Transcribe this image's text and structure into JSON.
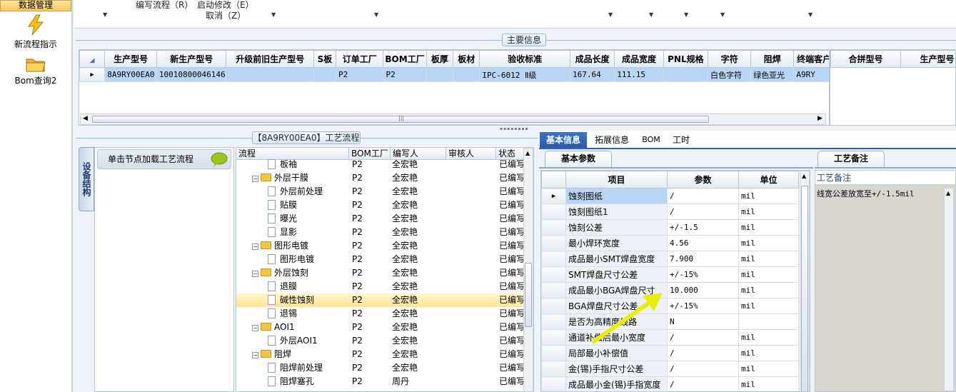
{
  "nav": {
    "header": "数据管理",
    "items": [
      {
        "label": "新流程指示",
        "icon": "lightning-icon"
      },
      {
        "label": "Bom查询2",
        "icon": "folder-icon"
      }
    ]
  },
  "toolbar": {
    "edit_flow": "编写流程（R）",
    "start_modify": "启动修改（E）",
    "cancel": "取消（Z）"
  },
  "main_info": {
    "title": "主要信息",
    "columns": [
      "生产型号",
      "新生产型号",
      "升级前旧生产型号",
      "S板",
      "订单工厂",
      "BOM工厂",
      "板厚",
      "板材",
      "验收标准",
      "成品长度",
      "成品宽度",
      "PNL规格",
      "字符",
      "阻焊",
      "终端客户代"
    ],
    "rows": [
      [
        "8A9RY00EA0",
        "10010800046146",
        "",
        "",
        "P2",
        "P2",
        "",
        "",
        "IPC-6012 Ⅱ级",
        "167.64",
        "111.15",
        "",
        "白色字符",
        "绿色亚光",
        "A9RY"
      ]
    ],
    "side_columns": [
      "合拼型号",
      "生产型号"
    ]
  },
  "flow": {
    "title": "【8A9RY00EA0】工艺流程",
    "device_tab": "设备结构",
    "load_hint": "单击节点加载工艺流程",
    "columns": [
      "流程",
      "BOM工厂",
      "编写人",
      "审核人",
      "状态"
    ],
    "rows": [
      {
        "name": "板袖",
        "kind": "doc",
        "level": 2,
        "bom": "P2",
        "author": "全宏艳",
        "reviewer": "",
        "status": "已编写"
      },
      {
        "name": "外层干膜",
        "kind": "folder",
        "level": 1,
        "bom": "P2",
        "author": "全宏艳",
        "reviewer": "",
        "status": "已编写"
      },
      {
        "name": "外层前处理",
        "kind": "doc",
        "level": 2,
        "bom": "P2",
        "author": "全宏艳",
        "reviewer": "",
        "status": "已编写"
      },
      {
        "name": "贴膜",
        "kind": "doc",
        "level": 2,
        "bom": "P2",
        "author": "全宏艳",
        "reviewer": "",
        "status": "已编写"
      },
      {
        "name": "曝光",
        "kind": "doc",
        "level": 2,
        "bom": "P2",
        "author": "全宏艳",
        "reviewer": "",
        "status": "已编写"
      },
      {
        "name": "显影",
        "kind": "doc",
        "level": 2,
        "bom": "P2",
        "author": "全宏艳",
        "reviewer": "",
        "status": "已编写"
      },
      {
        "name": "图形电镀",
        "kind": "folder",
        "level": 1,
        "bom": "P2",
        "author": "全宏艳",
        "reviewer": "",
        "status": "已编写"
      },
      {
        "name": "图形电镀",
        "kind": "doc",
        "level": 2,
        "bom": "P2",
        "author": "全宏艳",
        "reviewer": "",
        "status": "已编写"
      },
      {
        "name": "外层蚀刻",
        "kind": "folder",
        "level": 1,
        "bom": "P2",
        "author": "全宏艳",
        "reviewer": "",
        "status": "已编写"
      },
      {
        "name": "退膜",
        "kind": "doc",
        "level": 2,
        "bom": "P2",
        "author": "全宏艳",
        "reviewer": "",
        "status": "已编写"
      },
      {
        "name": "碱性蚀刻",
        "kind": "doc",
        "level": 2,
        "bom": "P2",
        "author": "全宏艳",
        "reviewer": "",
        "status": "已编写",
        "selected": true
      },
      {
        "name": "退锡",
        "kind": "doc",
        "level": 2,
        "bom": "P2",
        "author": "全宏艳",
        "reviewer": "",
        "status": "已编写"
      },
      {
        "name": "AOI1",
        "kind": "folder",
        "level": 1,
        "bom": "P2",
        "author": "全宏艳",
        "reviewer": "",
        "status": "已编写"
      },
      {
        "name": "外层AOI1",
        "kind": "doc",
        "level": 2,
        "bom": "P2",
        "author": "全宏艳",
        "reviewer": "",
        "status": "已编写"
      },
      {
        "name": "阻焊",
        "kind": "folder",
        "level": 1,
        "bom": "P2",
        "author": "全宏艳",
        "reviewer": "",
        "status": "已编写"
      },
      {
        "name": "阻焊前处理",
        "kind": "doc",
        "level": 2,
        "bom": "P2",
        "author": "全宏艳",
        "reviewer": "",
        "status": "已编写"
      },
      {
        "name": "阻焊塞孔",
        "kind": "doc",
        "level": 2,
        "bom": "P2",
        "author": "周丹",
        "reviewer": "",
        "status": "已编写"
      }
    ]
  },
  "right_tabs": [
    "基本信息",
    "拓展信息",
    "BOM",
    "工时"
  ],
  "params": {
    "subtab": "基本参数",
    "columns": [
      "项目",
      "参数",
      "单位"
    ],
    "rows": [
      [
        "蚀刻图纸",
        "/",
        "mil"
      ],
      [
        "蚀刻图纸1",
        "/",
        "mil"
      ],
      [
        "蚀刻公差",
        "+/-1.5",
        "mil"
      ],
      [
        "最小焊环宽度",
        "4.56",
        "mil"
      ],
      [
        "成品最小SMT焊盘宽度",
        "7.900",
        "mil"
      ],
      [
        "SMT焊盘尺寸公差",
        "+/-15%",
        "mil"
      ],
      [
        "成品最小BGA焊盘尺寸",
        "10.000",
        "mil"
      ],
      [
        "BGA焊盘尺寸公差",
        "+/-15%",
        "mil"
      ],
      [
        "是否为高精度线路",
        "N",
        ""
      ],
      [
        "通道补偿后最小宽度",
        "/",
        "mil"
      ],
      [
        "局部最小补偿值",
        "/",
        "mil"
      ],
      [
        "金(锡)手指尺寸公差",
        "/",
        "mil"
      ],
      [
        "成品最小金(锡)手指宽度",
        "/",
        "mil"
      ]
    ]
  },
  "notes": {
    "subtab": "工艺备注",
    "header": "工艺备注",
    "text": "线宽公差放宽至+/-1.5mil"
  },
  "colors": {
    "selection": "#b8d5f5",
    "tab_active": "#2f63b6",
    "highlight_row": "#ffe59a",
    "arrow": "#e8f000"
  }
}
